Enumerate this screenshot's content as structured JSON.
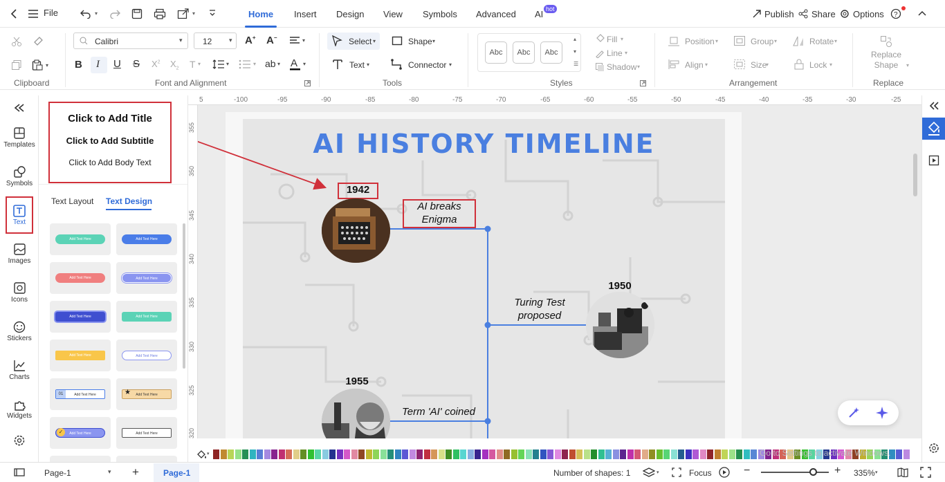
{
  "topbar": {
    "file": "File",
    "tabs": [
      "Home",
      "Insert",
      "Design",
      "View",
      "Symbols",
      "Advanced",
      "AI"
    ],
    "ai_badge": "hot",
    "publish": "Publish",
    "share": "Share",
    "options": "Options"
  },
  "ribbon": {
    "font_name": "Calibri",
    "font_size": "12",
    "select": "Select",
    "shape": "Shape",
    "text": "Text",
    "connector": "Connector",
    "fill": "Fill",
    "line": "Line",
    "shadow": "Shadow",
    "style_sample": "Abc",
    "position": "Position",
    "group": "Group",
    "rotate": "Rotate",
    "align": "Align",
    "size": "Size",
    "lock": "Lock",
    "replace_shape": "Replace Shape",
    "groups": {
      "clipboard": "Clipboard",
      "font": "Font and Alignment",
      "tools": "Tools",
      "styles": "Styles",
      "arrangement": "Arrangement",
      "replace": "Replace"
    }
  },
  "sidebar": {
    "items": [
      "Templates",
      "Symbols",
      "Text",
      "Images",
      "Icons",
      "Stickers",
      "Charts",
      "Widgets"
    ]
  },
  "panel": {
    "add_title": "Click to Add Title",
    "add_subtitle": "Click to Add Subtitle",
    "add_body": "Click to Add Body Text",
    "tab_layout": "Text Layout",
    "tab_design": "Text Design",
    "design_items": [
      {
        "text": "Add Text Here",
        "bg": "#5bd3b6",
        "fg": "#ffffff"
      },
      {
        "text": "Add Text Here",
        "bg": "#4a7de8",
        "fg": "#ffffff"
      },
      {
        "text": "Add Text Here",
        "bg": "#f07f7f",
        "fg": "#ffffff"
      },
      {
        "text": "Add Text Here",
        "bg": "#8a95f0",
        "fg": "#ffffff"
      },
      {
        "text": "Add Text Here",
        "bg": "#3f4fd0",
        "fg": "#ffffff"
      },
      {
        "text": "Add Text Here",
        "bg": "#5bd3b6",
        "fg": "#ffffff"
      },
      {
        "text": "Add Text Here",
        "bg": "#f9c64a",
        "fg": "#ffffff"
      },
      {
        "text": "Add Text Here",
        "bg": "#ffffff",
        "fg": "#6a7ae0"
      },
      {
        "text": "Add Text Here",
        "bg": "#ffffff",
        "fg": "#333333"
      },
      {
        "text": "Add Text Here",
        "bg": "#f7d9a6",
        "fg": "#333333"
      },
      {
        "text": "Add Text Here",
        "bg": "#8a95f0",
        "fg": "#ffffff"
      },
      {
        "text": "Add Text Here",
        "bg": "#ffffff",
        "fg": "#333333"
      }
    ],
    "badge_01": "01"
  },
  "ruler": {
    "top": [
      "5",
      "-100",
      "-95",
      "-90",
      "-85",
      "-80",
      "-75",
      "-70",
      "-65",
      "-60",
      "-55",
      "-50",
      "-45",
      "-40",
      "-35",
      "-30",
      "-25"
    ],
    "left": [
      "355",
      "350",
      "345",
      "340",
      "335",
      "330",
      "325",
      "320"
    ]
  },
  "slide": {
    "title": "AI HISTORY TIMELINE",
    "events": [
      {
        "year": "1942",
        "label": "AI breaks Enigma"
      },
      {
        "year": "1950",
        "label": "Turing Test proposed"
      },
      {
        "year": "1955",
        "label": "Term 'AI' coined"
      }
    ]
  },
  "watermark": "Go to Settings to activate Windows.",
  "statusbar": {
    "page_select": "Page-1",
    "page_tab": "Page-1",
    "shapes": "Number of shapes: 1",
    "focus": "Focus",
    "zoom": "335%"
  },
  "colors": {
    "accent": "#2f6bd8",
    "title_blue": "#4a7fe0",
    "highlight_red": "#d0303a"
  }
}
